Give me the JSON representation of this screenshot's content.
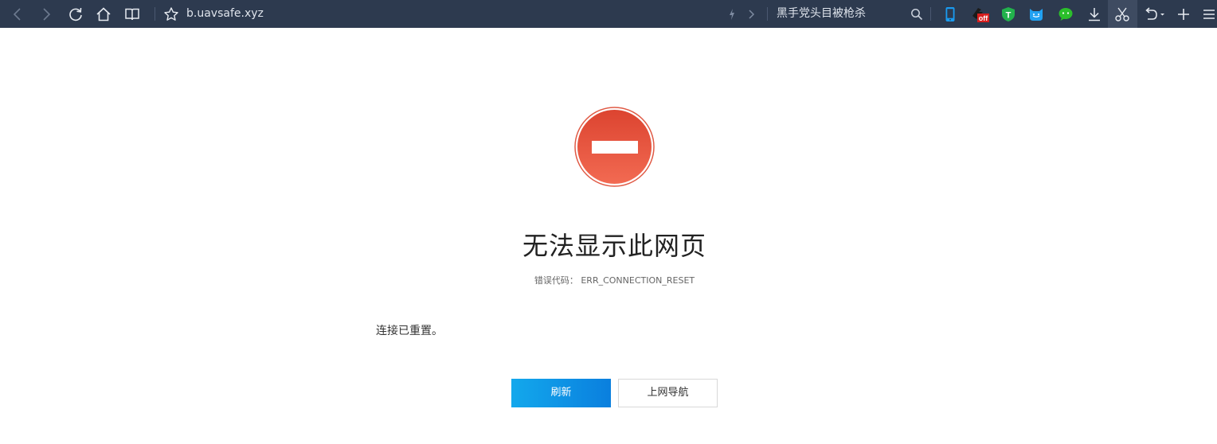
{
  "toolbar": {
    "url": "b.uavsafe.xyz",
    "search_text": "黑手党头目被枪杀",
    "buttons": [
      "back-icon",
      "forward-icon",
      "refresh-icon",
      "home-icon",
      "reader-icon",
      "star-icon",
      "lightning-icon",
      "chevron-right-icon",
      "search-icon",
      "mobile-icon",
      "off-icon",
      "t-icon",
      "cat-icon",
      "wechat-icon",
      "download-icon",
      "scissors-icon",
      "undo-icon",
      "plus-icon",
      "menu-icon"
    ],
    "off_badge": "off",
    "t_badge": "T"
  },
  "error": {
    "title": "无法显示此网页",
    "code_label": "错误代码：",
    "code": "ERR_CONNECTION_RESET",
    "message": "连接已重置。",
    "icon": "no-entry-icon"
  },
  "actions": {
    "refresh_label": "刷新",
    "nav_label": "上网导航"
  },
  "colors": {
    "toolbar_bg": "#2d3a4f",
    "error_red": "#e5533c",
    "primary_button": "#0a8fe6"
  }
}
